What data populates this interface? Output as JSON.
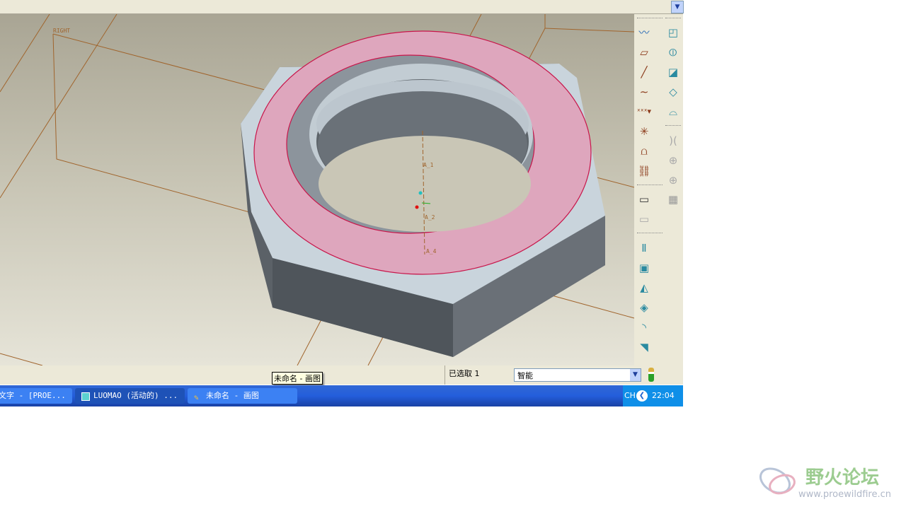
{
  "topbar": {
    "dropdown_icon": "chevron-down-icon"
  },
  "viewport": {
    "datum_labels": {
      "plane": "RIGHT",
      "axis1": "A_1",
      "axis2": "A_2",
      "axis4": "A_4"
    }
  },
  "toolbar": {
    "icons": [
      "datum-curve-sketch-icon",
      "datum-plane-icon",
      "datum-axis-icon",
      "datum-curve-icon",
      "datum-point-icon",
      "coordinate-system-icon",
      "analysis-icon",
      "chain-link-icon",
      "annotation-icon",
      "annotation-group-icon",
      "hole-icon",
      "shell-icon",
      "rib-icon",
      "draft-icon",
      "round-icon",
      "chamfer-icon",
      "extrude-icon",
      "revolve-icon",
      "sweep-icon",
      "blend-icon",
      "boundary-surface-icon",
      "mirror-icon",
      "merge-icon",
      "trim-icon",
      "pattern-icon"
    ]
  },
  "status": {
    "tooltip": "未命名 - 画图",
    "selected": "已选取 1",
    "filter_value": "智能"
  },
  "taskbar": {
    "tasks": [
      "文字 - [PROE...",
      "LUOMAO (活动的) ...",
      "未命名 - 画图"
    ],
    "lang": "CH",
    "clock": "22:04"
  },
  "watermark": {
    "title": "野火论坛",
    "url": "www.proewildfire.cn"
  }
}
